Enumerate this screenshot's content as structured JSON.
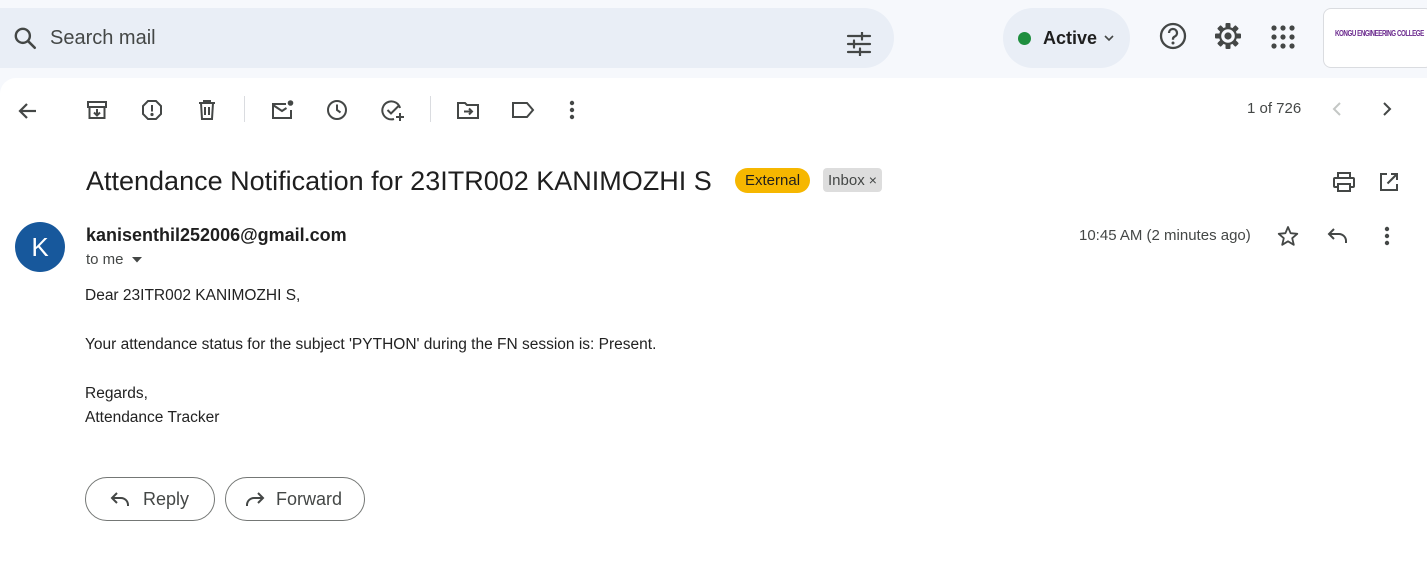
{
  "search": {
    "placeholder": "Search mail"
  },
  "status": {
    "label": "Active",
    "color": "#1e8e3e"
  },
  "account": {
    "logo_text": "KONGU ENGINEERING COLLEGE"
  },
  "toolbar": {
    "pager": "1 of 726"
  },
  "email": {
    "subject": "Attendance Notification for 23ITR002 KANIMOZHI S",
    "labels": {
      "external": "External",
      "inbox": "Inbox",
      "inbox_remove": "×"
    },
    "sender": "kanisenthil252006@gmail.com",
    "avatar_letter": "K",
    "recipient": "to me",
    "timestamp": "10:45 AM (2 minutes ago)",
    "body": {
      "greeting": "Dear 23ITR002 KANIMOZHI S,",
      "message": "Your attendance status for the subject 'PYTHON' during the FN session is: Present.",
      "closing": "Regards,",
      "signature": "Attendance Tracker"
    }
  },
  "actions": {
    "reply_label": "Reply",
    "forward_label": "Forward"
  },
  "colors": {
    "external_label": "#f6b700",
    "avatar": "#17589c",
    "app_background": "#f6f8fc",
    "search_background": "#e9eef6"
  }
}
